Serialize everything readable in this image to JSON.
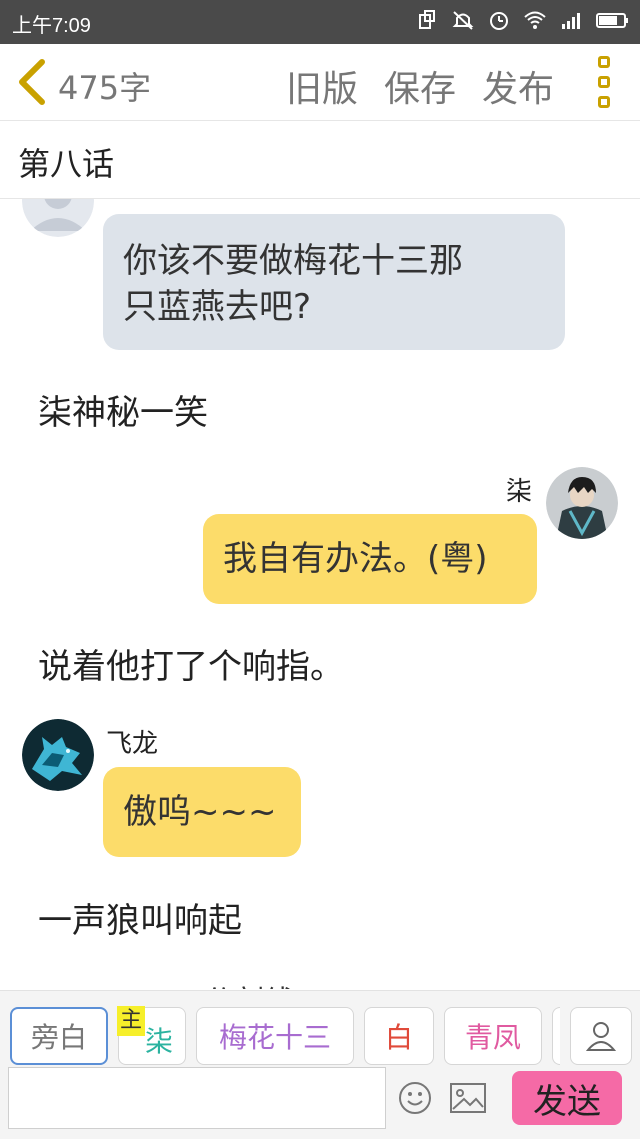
{
  "status_bar": {
    "time": "上午7:09"
  },
  "toolbar": {
    "word_count": "475字",
    "old_version": "旧版",
    "save": "保存",
    "publish": "发布"
  },
  "chapter_title": "第八话",
  "messages": {
    "m1_text_line1": "你该不要做梅花十三那",
    "m1_text_line2": "只蓝燕去吧?",
    "narr1": "柒神秘一笑",
    "m2_speaker": "柒",
    "m2_text": "我自有办法。(粤)",
    "narr2": "说着他打了个响指。",
    "m3_speaker": "飞龙",
    "m3_text": "傲呜~~~",
    "narr3": "一声狼叫响起",
    "narr4_partial": "分割线"
  },
  "role_bar": {
    "narrate": "旁白",
    "main_tag": "主",
    "qi": "柒",
    "meihua": "梅花十三",
    "bai": "白",
    "qingfeng": "青凤"
  },
  "composer": {
    "input_value": "",
    "send": "发送"
  },
  "colors": {
    "accent": "#c9a100",
    "yellow_bubble": "#fcdc6a",
    "grey_bubble": "#dde3ea",
    "send_button": "#f56aa6"
  }
}
